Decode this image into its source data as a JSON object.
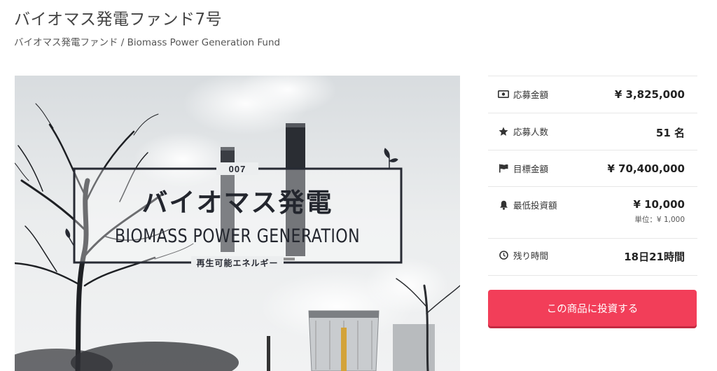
{
  "page": {
    "title": "バイオマス発電ファンド7号",
    "subtitle": "バイオマス発電ファンド / Biomass Power Generation Fund"
  },
  "hero": {
    "number": "007",
    "title_jp": "バイオマス発電",
    "title_en": "BIOMASS POWER GENERATION",
    "tagline": "再生可能エネルギー"
  },
  "stats": {
    "applied_amount": {
      "icon": "money-icon",
      "label": "応募金額",
      "value": "¥ 3,825,000"
    },
    "applicants": {
      "icon": "star-icon",
      "label": "応募人数",
      "value": "51 名"
    },
    "target_amount": {
      "icon": "flag-icon",
      "label": "目標金額",
      "value": "¥ 70,400,000"
    },
    "min_investment": {
      "icon": "bell-icon",
      "label": "最低投資額",
      "value": "¥ 10,000",
      "unit": "単位：¥ 1,000"
    },
    "time_left": {
      "icon": "clock-icon",
      "label": "残り時間",
      "value": "18日21時間"
    }
  },
  "cta": {
    "label": "この商品に投資する",
    "color": "#f23e59"
  }
}
